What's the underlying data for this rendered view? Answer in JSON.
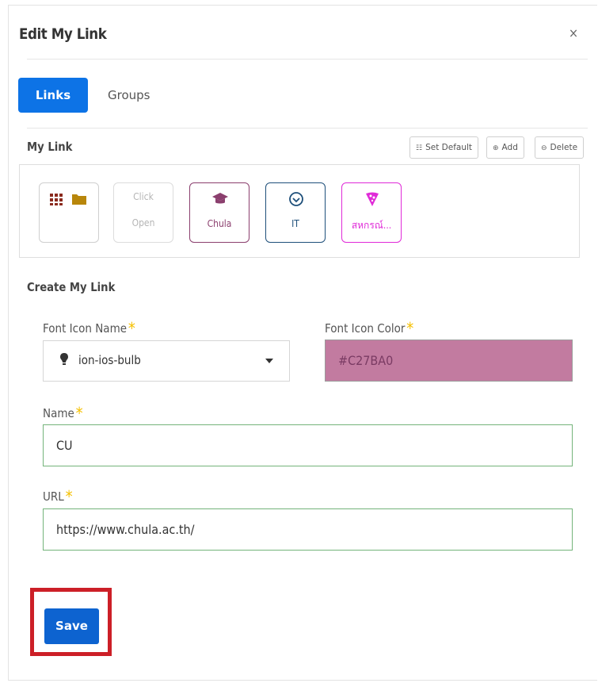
{
  "modal": {
    "title": "Edit My Link",
    "close_label": "×"
  },
  "tabs": [
    {
      "label": "Links",
      "active": true
    },
    {
      "label": "Groups",
      "active": false
    }
  ],
  "my_link": {
    "heading": "My Link",
    "actions": {
      "set_default": "Set Default",
      "add": "Add",
      "delete": "Delete"
    },
    "tiles": [
      {
        "label": "",
        "icons": [
          "grid-icon",
          "folder-icon"
        ],
        "color": "#8a8a8a"
      },
      {
        "label": "Click Open",
        "line1": "Click",
        "line2": "Open",
        "color": "#bbbbbb"
      },
      {
        "label": "Chula",
        "icon": "graduation-cap-icon",
        "color": "#8b3f6e"
      },
      {
        "label": "IT",
        "icon": "check-circle-icon",
        "color": "#1e4f7a"
      },
      {
        "label": "สหกรณ์...",
        "icon": "pizza-icon",
        "color": "#e02bd8"
      }
    ]
  },
  "create": {
    "heading": "Create My Link",
    "font_icon_name": {
      "label": "Font Icon Name",
      "value": "ion-ios-bulb",
      "icon": "bulb-icon"
    },
    "font_icon_color": {
      "label": "Font Icon Color",
      "value": "#C27BA0"
    },
    "name": {
      "label": "Name",
      "value": "CU"
    },
    "url": {
      "label": "URL",
      "value": "https://www.chula.ac.th/"
    },
    "required_mark": "*",
    "save_label": "Save"
  },
  "colors": {
    "primary": "#0d73e6",
    "icon_color_swatch": "#C27BA0",
    "highlight": "#cc1f27"
  }
}
